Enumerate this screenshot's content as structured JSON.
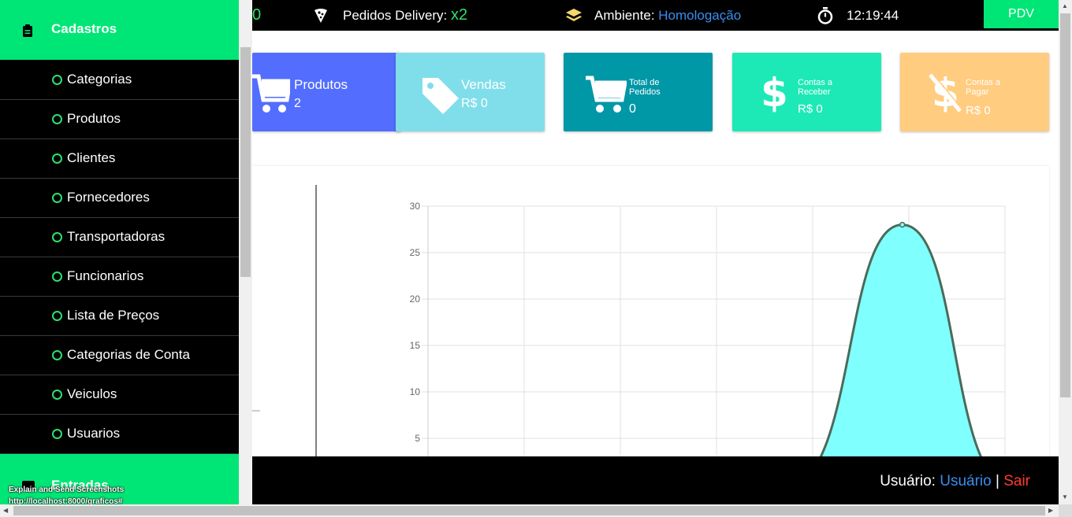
{
  "topbar": {
    "partial_value": "0",
    "delivery_label": "Pedidos Delivery: ",
    "delivery_value": "x2",
    "ambiente_label": "Ambiente: ",
    "ambiente_value": "Homologação",
    "clock": "12:19:44",
    "pdv_label": "PDV"
  },
  "cards": [
    {
      "title": "Produtos",
      "value": "2",
      "color": "#536dfe",
      "icon": "cart-icon"
    },
    {
      "title": "Vendas",
      "value": "R$ 0",
      "color": "#80deea",
      "icon": "tag-icon"
    },
    {
      "title": "Total de Pedidos",
      "value": "0",
      "color": "#0097a7",
      "icon": "cart-icon"
    },
    {
      "title": "Contas a Receber",
      "value": "R$ 0",
      "color": "#1de9b6",
      "icon": "dollar-icon"
    },
    {
      "title": "Contas a Pagar",
      "value": "R$ 0",
      "color": "#ffcc80",
      "icon": "dollar-off-icon"
    }
  ],
  "chart_data": {
    "type": "area",
    "yticks": [
      "5",
      "10",
      "15",
      "20",
      "25",
      "30"
    ],
    "ylim": [
      0,
      30
    ],
    "grid": true,
    "series": [
      {
        "points": [
          [
            0,
            0
          ],
          [
            1,
            0
          ],
          [
            2,
            0
          ],
          [
            3,
            0
          ],
          [
            4,
            28
          ],
          [
            5,
            0
          ]
        ],
        "fill": "#80ffff",
        "stroke": "#4a6b5a"
      }
    ]
  },
  "sidebar": {
    "section_title": "Cadastros",
    "items": [
      "Categorias",
      "Produtos",
      "Clientes",
      "Fornecedores",
      "Transportadoras",
      "Funcionarios",
      "Lista de Preços",
      "Categorias de Conta",
      "Veiculos",
      "Usuarios"
    ],
    "next_section": "Entradas"
  },
  "footer": {
    "user_label": "Usuário: ",
    "user_value": "Usuário",
    "separator": " | ",
    "logout": "Sair"
  },
  "overlay": {
    "line1": "Explain and Send Screenshots",
    "line2": "http://localhost:8000/graficos#"
  }
}
